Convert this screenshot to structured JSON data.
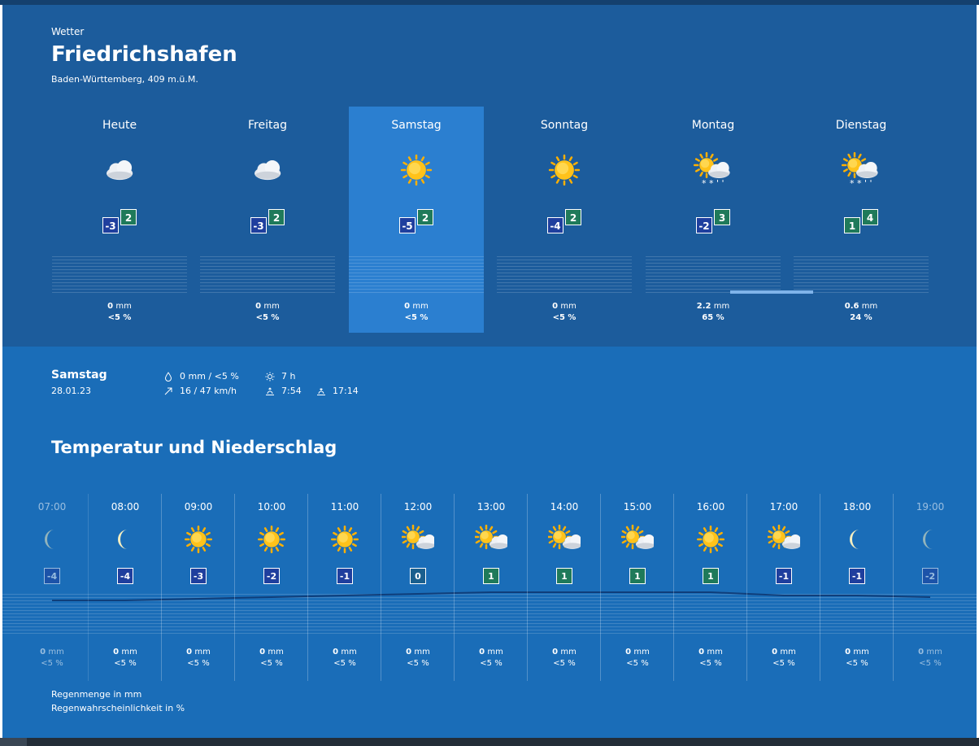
{
  "header": {
    "eyebrow": "Wetter",
    "city": "Friedrichshafen",
    "region": "Baden-Württemberg, 409 m.ü.M."
  },
  "days": [
    {
      "name": "Heute",
      "icon": "cloud-icon",
      "min": "-3",
      "max": "2",
      "mm": "0",
      "mm_unit": "mm",
      "pct": "<5 %",
      "rain_level": 0
    },
    {
      "name": "Freitag",
      "icon": "cloud-icon",
      "min": "-3",
      "max": "2",
      "mm": "0",
      "mm_unit": "mm",
      "pct": "<5 %",
      "rain_level": 0
    },
    {
      "name": "Samstag",
      "icon": "sun-icon",
      "min": "-5",
      "max": "2",
      "mm": "0",
      "mm_unit": "mm",
      "pct": "<5 %",
      "rain_level": 0
    },
    {
      "name": "Sonntag",
      "icon": "sun-icon",
      "min": "-4",
      "max": "2",
      "mm": "0",
      "mm_unit": "mm",
      "pct": "<5 %",
      "rain_level": 0
    },
    {
      "name": "Montag",
      "icon": "sun-cloud-snow-icon",
      "min": "-2",
      "max": "3",
      "mm": "2.2",
      "mm_unit": "mm",
      "pct": "65 %",
      "rain_level": 2.2
    },
    {
      "name": "Dienstag",
      "icon": "sun-cloud-snow-icon",
      "min": "1",
      "max": "4",
      "mm": "0.6",
      "mm_unit": "mm",
      "pct": "24 %",
      "rain_level": 0.6
    }
  ],
  "selected_day": 2,
  "detail": {
    "day": "Samstag",
    "date": "28.01.23",
    "precip": "0 mm / <5 %",
    "wind": "16 / 47 km/h",
    "sunshine": "7 h",
    "sunrise": "7:54",
    "sunset": "17:14"
  },
  "section_title": "Temperatur und Niederschlag",
  "hours": [
    {
      "time": "07:00",
      "icon": "moon-icon",
      "temp": "-4",
      "mm": "0",
      "pct": "<5 %"
    },
    {
      "time": "08:00",
      "icon": "moon-icon",
      "temp": "-4",
      "mm": "0",
      "pct": "<5 %"
    },
    {
      "time": "09:00",
      "icon": "sun-icon",
      "temp": "-3",
      "mm": "0",
      "pct": "<5 %"
    },
    {
      "time": "10:00",
      "icon": "sun-icon",
      "temp": "-2",
      "mm": "0",
      "pct": "<5 %"
    },
    {
      "time": "11:00",
      "icon": "sun-icon",
      "temp": "-1",
      "mm": "0",
      "pct": "<5 %"
    },
    {
      "time": "12:00",
      "icon": "sun-cloud-icon",
      "temp": "0",
      "mm": "0",
      "pct": "<5 %"
    },
    {
      "time": "13:00",
      "icon": "sun-cloud-icon",
      "temp": "1",
      "mm": "0",
      "pct": "<5 %"
    },
    {
      "time": "14:00",
      "icon": "sun-cloud-icon",
      "temp": "1",
      "mm": "0",
      "pct": "<5 %"
    },
    {
      "time": "15:00",
      "icon": "sun-cloud-icon",
      "temp": "1",
      "mm": "0",
      "pct": "<5 %"
    },
    {
      "time": "16:00",
      "icon": "sun-icon",
      "temp": "1",
      "mm": "0",
      "pct": "<5 %"
    },
    {
      "time": "17:00",
      "icon": "sun-cloud-icon",
      "temp": "-1",
      "mm": "0",
      "pct": "<5 %"
    },
    {
      "time": "18:00",
      "icon": "moon-icon",
      "temp": "-1",
      "mm": "0",
      "pct": "<5 %"
    },
    {
      "time": "19:00",
      "icon": "moon-icon",
      "temp": "-2",
      "mm": "0",
      "pct": "<5 %"
    }
  ],
  "mm_unit": "mm",
  "legend": {
    "amount": "Regenmenge in mm",
    "probability": "Regenwahrscheinlichkeit in %"
  },
  "colors": {
    "header_bg": "#1c5c9c",
    "page_bg": "#1a6db8",
    "selected_bg": "#2b7fd0",
    "temp_cold": "#1f3f9e",
    "temp_warm": "#1f7a5a",
    "temp_line": "#0f3e7a"
  }
}
